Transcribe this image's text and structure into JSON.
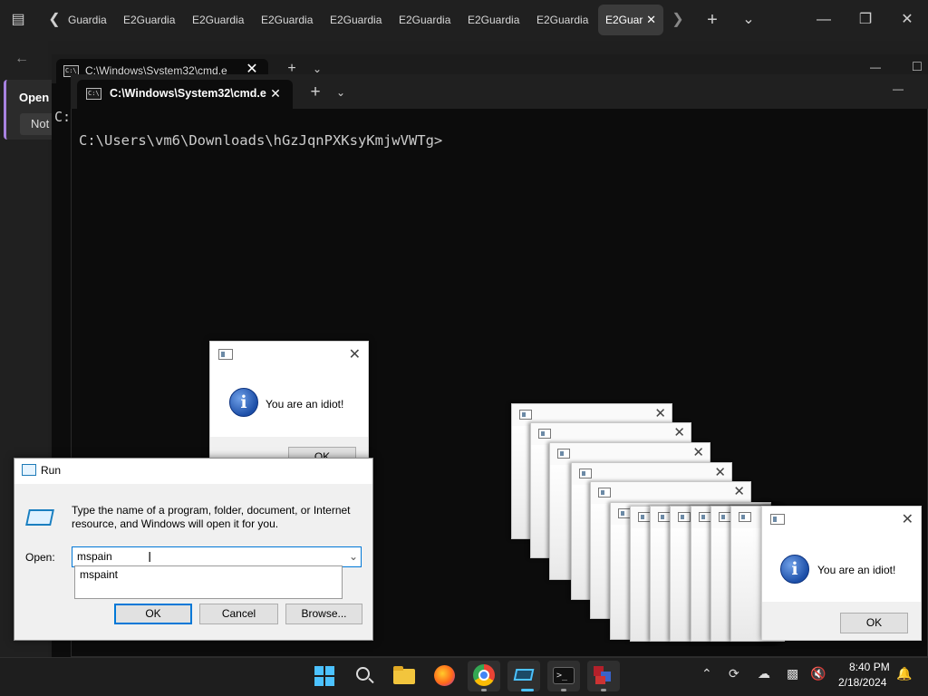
{
  "browser": {
    "tabs": [
      "Guardia",
      "E2Guardia",
      "E2Guardia",
      "E2Guardia",
      "E2Guardia",
      "E2Guardia",
      "E2Guardia",
      "E2Guardia"
    ],
    "active_tab": "E2Guar",
    "open_label": "Open",
    "not_label": "Not"
  },
  "terminal_back": {
    "tab_title": "C:\\Windows\\System32\\cmd.e",
    "prompt": "C:"
  },
  "terminal_front": {
    "tab_title": "C:\\Windows\\System32\\cmd.e",
    "prompt": "C:\\Users\\vm6\\Downloads\\hGzJqnPXKsyKmjwVWTg>"
  },
  "idiot_dialogs": {
    "message": "You are an idiot!",
    "ok_label": "OK"
  },
  "run_dialog": {
    "title": "Run",
    "description": "Type the name of a program, folder, document, or Internet resource, and Windows will open it for you.",
    "open_label": "Open:",
    "input_value": "mspain",
    "suggestion": "mspaint",
    "ok_label": "OK",
    "cancel_label": "Cancel",
    "browse_label": "Browse..."
  },
  "taskbar": {
    "time": "8:40 PM",
    "date": "2/18/2024",
    "apps": [
      "start-icon",
      "search-icon",
      "file-explorer-icon",
      "firefox-icon",
      "chrome-icon",
      "run-app-icon",
      "terminal-icon",
      "winrar-icon"
    ]
  }
}
